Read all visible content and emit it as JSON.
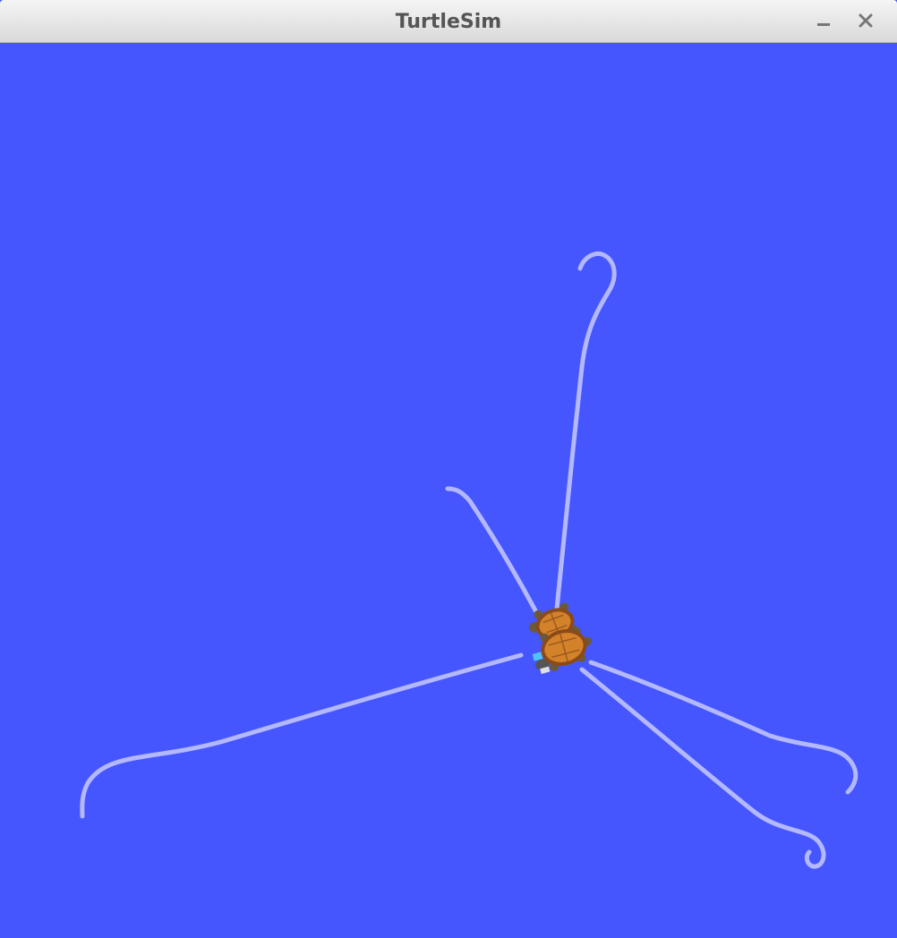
{
  "window": {
    "title": "TurtleSim",
    "minimize_icon": "minimize-icon",
    "close_icon": "close-icon"
  },
  "canvas": {
    "background_color": "#4556ff",
    "pen_color": "#b3b8ff",
    "turtle_count": 2,
    "turtle_shell_color": "#d4822a",
    "turtle_body_color": "#6b5a3a"
  }
}
